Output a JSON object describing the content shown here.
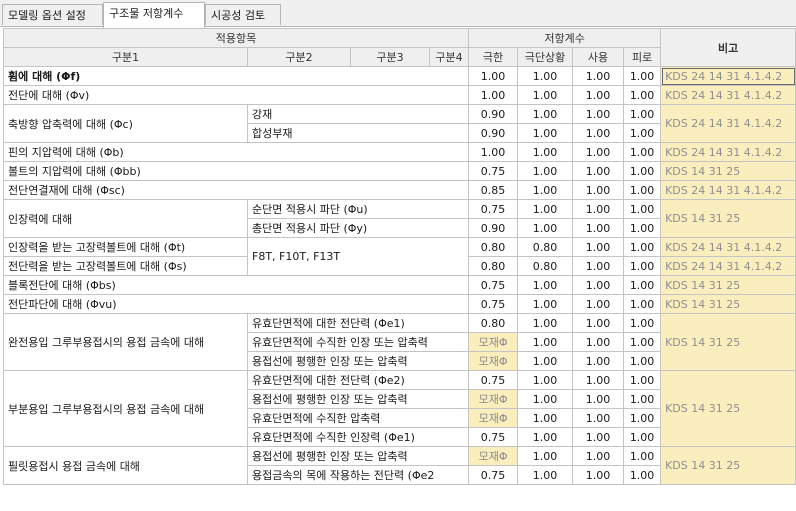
{
  "tabs": [
    "모델링 옵션 설정",
    "구조물 저항계수",
    "시공성 검토"
  ],
  "active_tab": 1,
  "headers": {
    "apply_items": "적용항목",
    "resistance": "저항계수",
    "remarks": "비고",
    "cat1": "구분1",
    "cat2": "구분2",
    "cat3": "구분3",
    "cat4": "구분4",
    "limit": "극한",
    "extreme": "극단상황",
    "service": "사용",
    "fatigue": "피로"
  },
  "rows": [
    {
      "c1": "휨에 대해 (Φf)",
      "lim": "1.00",
      "ext": "1.00",
      "srv": "1.00",
      "fat": "1.00",
      "ref": "KDS 24 14 31 4.1.4.2"
    },
    {
      "c1": "전단에 대해 (Φv)",
      "lim": "1.00",
      "ext": "1.00",
      "srv": "1.00",
      "fat": "1.00",
      "ref": "KDS 24 14 31 4.1.4.2"
    },
    {
      "c1": "축방향 압축력에 대해 (Φc)",
      "c2": "강재",
      "lim": "0.90",
      "ext": "1.00",
      "srv": "1.00",
      "fat": "1.00",
      "ref": "KDS 24 14 31 4.1.4.2"
    },
    {
      "c2": "합성부재",
      "lim": "0.90",
      "ext": "1.00",
      "srv": "1.00",
      "fat": "1.00"
    },
    {
      "c1": "핀의 지압력에 대해 (Φb)",
      "lim": "1.00",
      "ext": "1.00",
      "srv": "1.00",
      "fat": "1.00",
      "ref": "KDS 24 14 31 4.1.4.2"
    },
    {
      "c1": "볼트의 지압력에 대해 (Φbb)",
      "lim": "0.75",
      "ext": "1.00",
      "srv": "1.00",
      "fat": "1.00",
      "ref": "KDS 14 31 25"
    },
    {
      "c1": "전단연결재에 대해 (Φsc)",
      "lim": "0.85",
      "ext": "1.00",
      "srv": "1.00",
      "fat": "1.00",
      "ref": "KDS 24 14 31 4.1.4.2"
    },
    {
      "c1": "인장력에 대해",
      "c2": "순단면 적용시 파단 (Φu)",
      "lim": "0.75",
      "ext": "1.00",
      "srv": "1.00",
      "fat": "1.00",
      "ref": "KDS 14 31 25"
    },
    {
      "c2": "총단면 적용시 파단 (Φy)",
      "lim": "0.90",
      "ext": "1.00",
      "srv": "1.00",
      "fat": "1.00"
    },
    {
      "c1": "인장력을 받는 고장력볼트에 대해 (Φt)",
      "c2": "F8T, F10T, F13T",
      "lim": "0.80",
      "ext": "0.80",
      "srv": "1.00",
      "fat": "1.00",
      "ref": "KDS 24 14 31 4.1.4.2"
    },
    {
      "c1": "전단력을 받는 고장력볼트에 대해 (Φs)",
      "lim": "0.80",
      "ext": "0.80",
      "srv": "1.00",
      "fat": "1.00",
      "ref": "KDS 24 14 31 4.1.4.2"
    },
    {
      "c1": "블록전단에 대해 (Φbs)",
      "lim": "0.75",
      "ext": "1.00",
      "srv": "1.00",
      "fat": "1.00",
      "ref": "KDS 14 31 25"
    },
    {
      "c1": "전단파단에 대해 (Φvu)",
      "lim": "0.75",
      "ext": "1.00",
      "srv": "1.00",
      "fat": "1.00",
      "ref": "KDS 14 31 25"
    },
    {
      "c1": "완전용입 그루부용접시의 용접 금속에 대해",
      "c2": "유효단면적에 대한 전단력 (Φe1)",
      "lim": "0.80",
      "ext": "1.00",
      "srv": "1.00",
      "fat": "1.00",
      "ref": "KDS 14 31 25"
    },
    {
      "c2": "유효단면적에 수직한 인장 또는 압축력",
      "lim": "모재Φ",
      "ext": "1.00",
      "srv": "1.00",
      "fat": "1.00"
    },
    {
      "c2": "용접선에 평행한 인장 또는 압축력",
      "lim": "모재Φ",
      "ext": "1.00",
      "srv": "1.00",
      "fat": "1.00"
    },
    {
      "c1": "부분용입 그루부용접시의 용접 금속에 대해",
      "c2": "유효단면적에 대한 전단력 (Φe2)",
      "lim": "0.75",
      "ext": "1.00",
      "srv": "1.00",
      "fat": "1.00",
      "ref": "KDS 14 31 25"
    },
    {
      "c2": "용접선에 평행한 인장 또는 압축력",
      "lim": "모재Φ",
      "ext": "1.00",
      "srv": "1.00",
      "fat": "1.00"
    },
    {
      "c2": "유효단면적에 수직한 압축력",
      "lim": "모재Φ",
      "ext": "1.00",
      "srv": "1.00",
      "fat": "1.00"
    },
    {
      "c2": "유효단면적에 수직한 인장력 (Φe1)",
      "lim": "0.75",
      "ext": "1.00",
      "srv": "1.00",
      "fat": "1.00"
    },
    {
      "c1": "필릿용접시 용접 금속에 대해",
      "c2": "용접선에 평행한 인장 또는 압축력",
      "lim": "모재Φ",
      "ext": "1.00",
      "srv": "1.00",
      "fat": "1.00",
      "ref": "KDS 14 31 25"
    },
    {
      "c2": "용접금속의 목에 작용하는 전단력 (Φe2",
      "lim": "0.75",
      "ext": "1.00",
      "srv": "1.00",
      "fat": "1.00"
    }
  ],
  "colors": {
    "highlight": "#fbeebe",
    "header_bg": "#efefef",
    "grid": "#c4c4c4"
  }
}
